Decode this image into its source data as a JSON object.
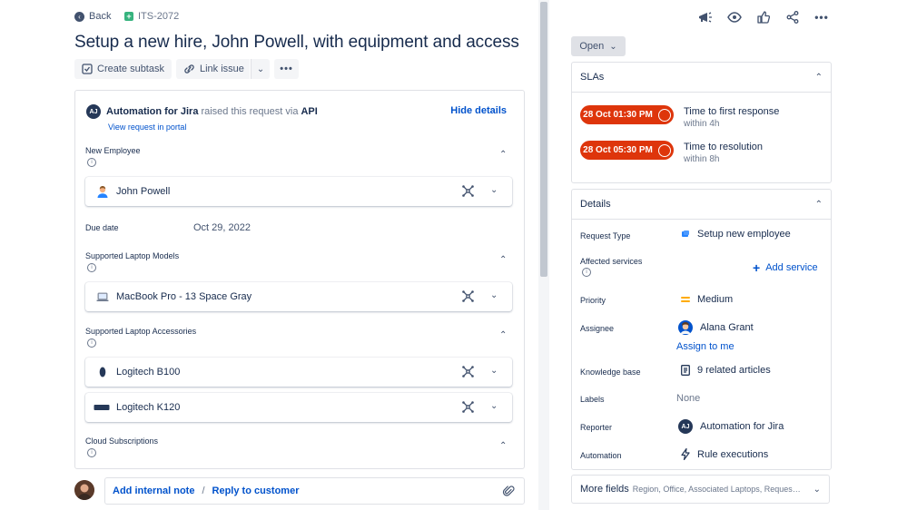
{
  "nav": {
    "back_label": "Back",
    "issue_key": "ITS-2072"
  },
  "issue": {
    "title": "Setup a new hire, John Powell, with equipment and access"
  },
  "toolbar": {
    "create_subtask": "Create subtask",
    "link_issue": "Link issue"
  },
  "request": {
    "avatar_initials": "AJ",
    "reporter_name": "Automation for Jira",
    "raised_text": "raised this request via",
    "channel": "API",
    "hide_details": "Hide details",
    "view_portal": "View request in portal",
    "new_employee_label": "New Employee",
    "new_employee_value": "John Powell",
    "due_date_label": "Due date",
    "due_date_value": "Oct 29, 2022",
    "laptop_models_label": "Supported Laptop Models",
    "laptop_model_value": "MacBook Pro - 13 Space Gray",
    "accessories_label": "Supported Laptop Accessories",
    "accessory_1": "Logitech B100",
    "accessory_2": "Logitech K120",
    "cloud_label": "Cloud Subscriptions"
  },
  "comment": {
    "add_internal_note": "Add internal note",
    "separator": "/",
    "reply_to_customer": "Reply to customer"
  },
  "status": {
    "label": "Open"
  },
  "slas": {
    "header": "SLAs",
    "items": [
      {
        "time": "28 Oct 01:30 PM",
        "title": "Time to first response",
        "sub": "within 4h"
      },
      {
        "time": "28 Oct 05:30 PM",
        "title": "Time to resolution",
        "sub": "within 8h"
      }
    ]
  },
  "details": {
    "header": "Details",
    "request_type_label": "Request Type",
    "request_type_value": "Setup new employee",
    "affected_label": "Affected services",
    "add_service": "Add service",
    "priority_label": "Priority",
    "priority_value": "Medium",
    "assignee_label": "Assignee",
    "assignee_value": "Alana Grant",
    "assign_to_me": "Assign to me",
    "kb_label": "Knowledge base",
    "kb_value": "9 related articles",
    "labels_label": "Labels",
    "labels_value": "None",
    "reporter_label": "Reporter",
    "reporter_value": "Automation for Jira",
    "automation_label": "Automation",
    "automation_value": "Rule executions"
  },
  "more_fields": {
    "label": "More fields",
    "summary": "Region, Office, Associated Laptops, Requested Ass..."
  },
  "colors": {
    "accent": "#0052cc",
    "sla_breach": "#de350b",
    "priority_medium": "#ffab00",
    "key_icon": "#36b37e"
  }
}
